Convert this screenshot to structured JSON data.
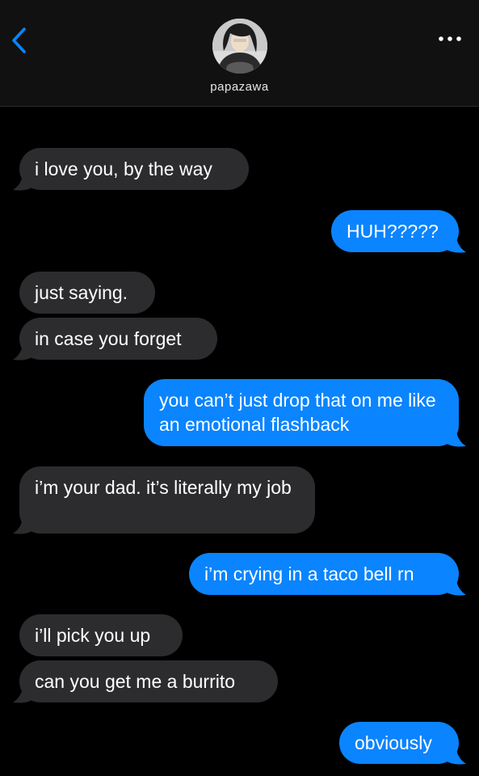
{
  "header": {
    "back_icon": "chevron-left-icon",
    "more_icon": "more-horizontal-icon",
    "contact_name": "papazawa",
    "accent_color": "#0a84ff"
  },
  "messages": [
    {
      "direction": "incoming",
      "text": "i love you, by the way"
    },
    {
      "direction": "outgoing",
      "text": "HUH?????"
    },
    {
      "direction": "incoming",
      "text": "just saying."
    },
    {
      "direction": "incoming",
      "text": "in case you forget"
    },
    {
      "direction": "outgoing",
      "text": "you can’t just drop that on me like an emotional flashback"
    },
    {
      "direction": "incoming",
      "text": "i’m your dad. it’s literally my job"
    },
    {
      "direction": "outgoing",
      "text": "i’m crying in a taco bell rn"
    },
    {
      "direction": "incoming",
      "text": "i’ll pick you up"
    },
    {
      "direction": "incoming",
      "text": "can you get me a burrito"
    },
    {
      "direction": "outgoing",
      "text": "obviously"
    }
  ],
  "colors": {
    "incoming_bubble": "#2c2c2e",
    "outgoing_bubble": "#0a84ff",
    "background": "#000000",
    "header_bg": "#111111"
  }
}
